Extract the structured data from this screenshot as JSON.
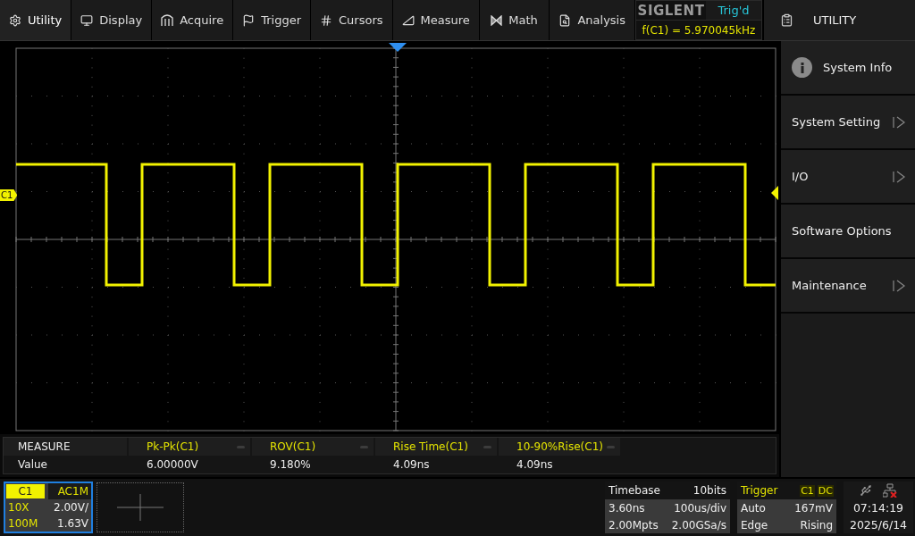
{
  "menu_bar": [
    {
      "label": "Utility",
      "selected": true
    },
    {
      "label": "Display",
      "selected": false
    },
    {
      "label": "Acquire",
      "selected": false
    },
    {
      "label": "Trigger",
      "selected": false
    },
    {
      "label": "Cursors",
      "selected": false
    },
    {
      "label": "Measure",
      "selected": false
    },
    {
      "label": "Math",
      "selected": false
    },
    {
      "label": "Analysis",
      "selected": false
    }
  ],
  "brand": {
    "logo": "SIGLENT",
    "trigger_status": "Trig'd",
    "frequency": "f(C1) = 5.970045kHz"
  },
  "side_panel": {
    "title": "UTILITY",
    "items": [
      {
        "label": "System Info",
        "kind": "info",
        "submenu": false
      },
      {
        "label": "System Setting",
        "kind": "plain",
        "submenu": true
      },
      {
        "label": "I/O",
        "kind": "plain",
        "submenu": true
      },
      {
        "label": "Software Options",
        "kind": "plain",
        "submenu": false
      },
      {
        "label": "Maintenance",
        "kind": "plain",
        "submenu": true
      }
    ]
  },
  "scope": {
    "channel_marker": "C1"
  },
  "measure": {
    "title": "MEASURE",
    "row_label": "Value",
    "items": [
      {
        "name": "Pk-Pk(C1)",
        "value": "6.00000V"
      },
      {
        "name": "ROV(C1)",
        "value": "9.180%"
      },
      {
        "name": "Rise Time(C1)",
        "value": "4.09ns"
      },
      {
        "name": "10-90%Rise(C1)",
        "value": "4.09ns"
      }
    ]
  },
  "channel": {
    "name": "C1",
    "coupling": "AC1M",
    "probe": "10X",
    "scale": "2.00V/",
    "bandwidth": "100M",
    "offset": "1.63V",
    "selected": true
  },
  "timebase": {
    "title": "Timebase",
    "bits": "10bits",
    "delay": "3.60ns",
    "scale": "100us/div",
    "memory": "2.00Mpts",
    "sample_rate": "2.00GSa/s"
  },
  "trigger": {
    "title": "Trigger",
    "source": "C1",
    "coupling": "DC",
    "mode": "Auto",
    "level": "167mV",
    "type": "Edge",
    "slope": "Rising"
  },
  "clock": {
    "time": "07:14:19",
    "date": "2025/6/14"
  }
}
